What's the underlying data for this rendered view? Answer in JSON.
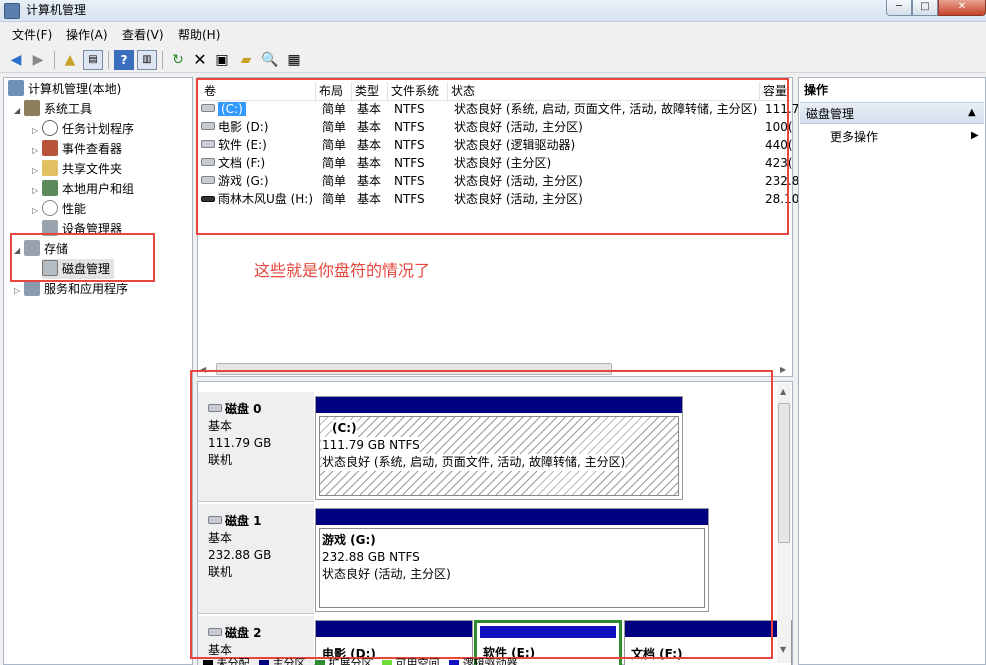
{
  "window": {
    "title": "计算机管理",
    "min": "─",
    "max": "□",
    "close": "✕"
  },
  "menubar": {
    "items": [
      "文件(F)",
      "操作(A)",
      "查看(V)",
      "帮助(H)"
    ]
  },
  "toolbar": {
    "icons": [
      "back-arrow-icon",
      "forward-arrow-icon",
      "up-folder-icon",
      "show-tree-icon",
      "help-icon",
      "show-pane-icon",
      "refresh-icon",
      "delete-icon",
      "properties-icon",
      "open-icon",
      "search-icon",
      "export-icon"
    ]
  },
  "tree": {
    "root": "计算机管理(本地)",
    "system_tools": "系统工具",
    "task_scheduler": "任务计划程序",
    "event_viewer": "事件查看器",
    "shared_folders": "共享文件夹",
    "local_users": "本地用户和组",
    "performance": "性能",
    "device_manager": "设备管理器",
    "storage": "存储",
    "disk_management": "磁盘管理",
    "services": "服务和应用程序"
  },
  "volumes": {
    "headers": [
      "卷",
      "布局",
      "类型",
      "文件系统",
      "状态",
      "容量"
    ],
    "rows": [
      {
        "vol": "(C:)",
        "layout": "简单",
        "type": "基本",
        "fs": "NTFS",
        "status": "状态良好 (系统, 启动, 页面文件, 活动, 故障转储, 主分区)",
        "cap": "111.7"
      },
      {
        "vol": "电影 (D:)",
        "layout": "简单",
        "type": "基本",
        "fs": "NTFS",
        "status": "状态良好 (活动, 主分区)",
        "cap": "100("
      },
      {
        "vol": "软件 (E:)",
        "layout": "简单",
        "type": "基本",
        "fs": "NTFS",
        "status": "状态良好 (逻辑驱动器)",
        "cap": "440("
      },
      {
        "vol": "文档 (F:)",
        "layout": "简单",
        "type": "基本",
        "fs": "NTFS",
        "status": "状态良好 (主分区)",
        "cap": "423("
      },
      {
        "vol": "游戏 (G:)",
        "layout": "简单",
        "type": "基本",
        "fs": "NTFS",
        "status": "状态良好 (活动, 主分区)",
        "cap": "232.8"
      },
      {
        "vol": "雨林木风U盘 (H:)",
        "layout": "简单",
        "type": "基本",
        "fs": "NTFS",
        "status": "状态良好 (活动, 主分区)",
        "cap": "28.10"
      }
    ]
  },
  "annotation": "这些就是你盘符的情况了",
  "disks": [
    {
      "name": "磁盘 0",
      "type": "基本",
      "size": "111.79 GB",
      "state": "联机",
      "part": {
        "title": "(C:)",
        "size": "111.79 GB NTFS",
        "status": "状态良好 (系统, 启动, 页面文件, 活动, 故障转储, 主分区)"
      }
    },
    {
      "name": "磁盘 1",
      "type": "基本",
      "size": "232.88 GB",
      "state": "联机",
      "part": {
        "title": "游戏  (G:)",
        "size": "232.88 GB NTFS",
        "status": "状态良好 (活动, 主分区)"
      }
    },
    {
      "name": "磁盘 2",
      "type": "基本",
      "parts": [
        "电影  (D:)",
        "软件  (E:)",
        "文档  (F:)"
      ]
    }
  ],
  "legend": [
    "未分配",
    "主分区",
    "扩展分区",
    "可用空间",
    "逻辑驱动器"
  ],
  "legend_colors": [
    "#000000",
    "#000080",
    "#2e8b2e",
    "#6fdc3a",
    "#1010c0"
  ],
  "actions": {
    "header": "操作",
    "section": "磁盘管理",
    "more": "更多操作"
  }
}
